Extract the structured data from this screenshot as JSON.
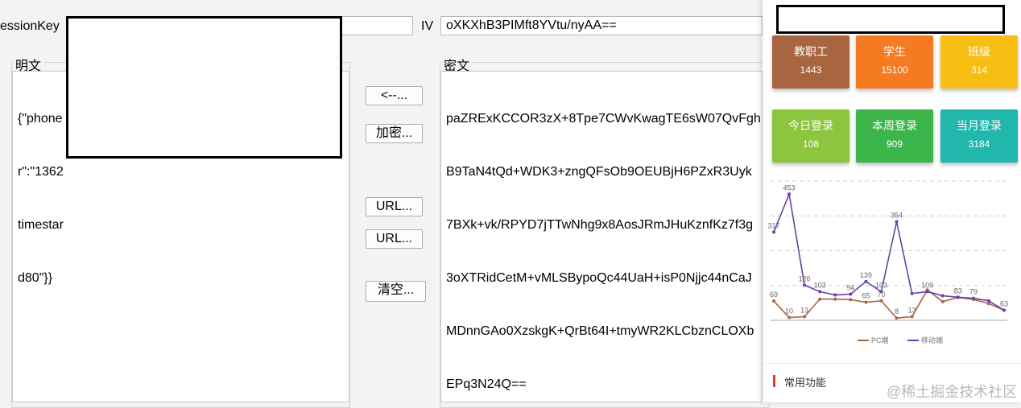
{
  "session_key": {
    "label": "essionKey",
    "value": ""
  },
  "iv": {
    "label": "IV",
    "value": "oXKXhB3PIMft8YVtu/nyAA=="
  },
  "plaintext": {
    "title": "明文",
    "lines": [
      "{\"phone",
      "r\":\"1362",
      "timestar",
      "d80\"}}"
    ]
  },
  "ciphertext": {
    "title": "密文",
    "lines": [
      "paZRExKCCOR3zX+8Tpe7CWvKwagTE6sW07QvFgh",
      "B9TaN4tQd+WDK3+zngQFsOb9OEUBjH6PZxR3Uyk",
      "7BXk+vk/RPYD7jTTwNhg9x8AosJRmJHuKznfKz7f3g",
      "3oXTRidCetM+vMLSBypoQc44UaH+isP0Njjc44nCaJ",
      "MDnnGAo0XzskgK+QrBt64I+tmyWR2KLCbznCLOXb",
      "EPq3N24Q=="
    ]
  },
  "buttons": {
    "decrypt": "<--...",
    "encrypt": "加密...",
    "url1": "URL...",
    "url2": "URL...",
    "clear": "清空..."
  },
  "dashboard": {
    "cards": [
      {
        "title": "教职工",
        "value": "1443",
        "color": "#a86540"
      },
      {
        "title": "学生",
        "value": "15100",
        "color": "#f57a21"
      },
      {
        "title": "班级",
        "value": "314",
        "color": "#f9be14"
      },
      {
        "title": "今日登录",
        "value": "108",
        "color": "#8cc63e"
      },
      {
        "title": "本周登录",
        "value": "909",
        "color": "#3cb64a"
      },
      {
        "title": "当月登录",
        "value": "3184",
        "color": "#22b7ad"
      }
    ],
    "section_title": "常用功能"
  },
  "chart_data": {
    "type": "line",
    "x": [
      1,
      2,
      3,
      4,
      5,
      6,
      7,
      8,
      9,
      10,
      11,
      12,
      13,
      14,
      15,
      16
    ],
    "ylim": [
      0,
      500
    ],
    "series": [
      {
        "name": "PC端",
        "color": "#a86540",
        "values": [
          69,
          10,
          13,
          76,
          76,
          74,
          65,
          70,
          8,
          13,
          109,
          67,
          82,
          75,
          60,
          36
        ]
      },
      {
        "name": "移动端",
        "color": "#6a3fa9",
        "values": [
          317,
          453,
          126,
          103,
          91,
          94,
          139,
          103,
          354,
          96,
          103,
          88,
          83,
          79,
          70,
          36
        ]
      }
    ],
    "point_labels": [
      {
        "series": 1,
        "index": 0,
        "text": "317"
      },
      {
        "series": 1,
        "index": 1,
        "text": "453"
      },
      {
        "series": 1,
        "index": 2,
        "text": "126"
      },
      {
        "series": 1,
        "index": 3,
        "text": "103"
      },
      {
        "series": 1,
        "index": 5,
        "text": "94"
      },
      {
        "series": 1,
        "index": 6,
        "text": "139"
      },
      {
        "series": 1,
        "index": 7,
        "text": "103"
      },
      {
        "series": 1,
        "index": 8,
        "text": "354"
      },
      {
        "series": 1,
        "index": 10,
        "text": "109"
      },
      {
        "series": 1,
        "index": 12,
        "text": "83"
      },
      {
        "series": 1,
        "index": 13,
        "text": "79"
      },
      {
        "series": 0,
        "index": 0,
        "text": "69"
      },
      {
        "series": 0,
        "index": 1,
        "text": "10"
      },
      {
        "series": 0,
        "index": 2,
        "text": "13"
      },
      {
        "series": 0,
        "index": 6,
        "text": "65"
      },
      {
        "series": 0,
        "index": 7,
        "text": "70"
      },
      {
        "series": 0,
        "index": 8,
        "text": "8"
      },
      {
        "series": 0,
        "index": 9,
        "text": "13"
      },
      {
        "series": 0,
        "index": 15,
        "text": "63"
      }
    ],
    "grid": true,
    "legend": "bottom-center"
  },
  "watermark": "@稀土掘金技术社区"
}
